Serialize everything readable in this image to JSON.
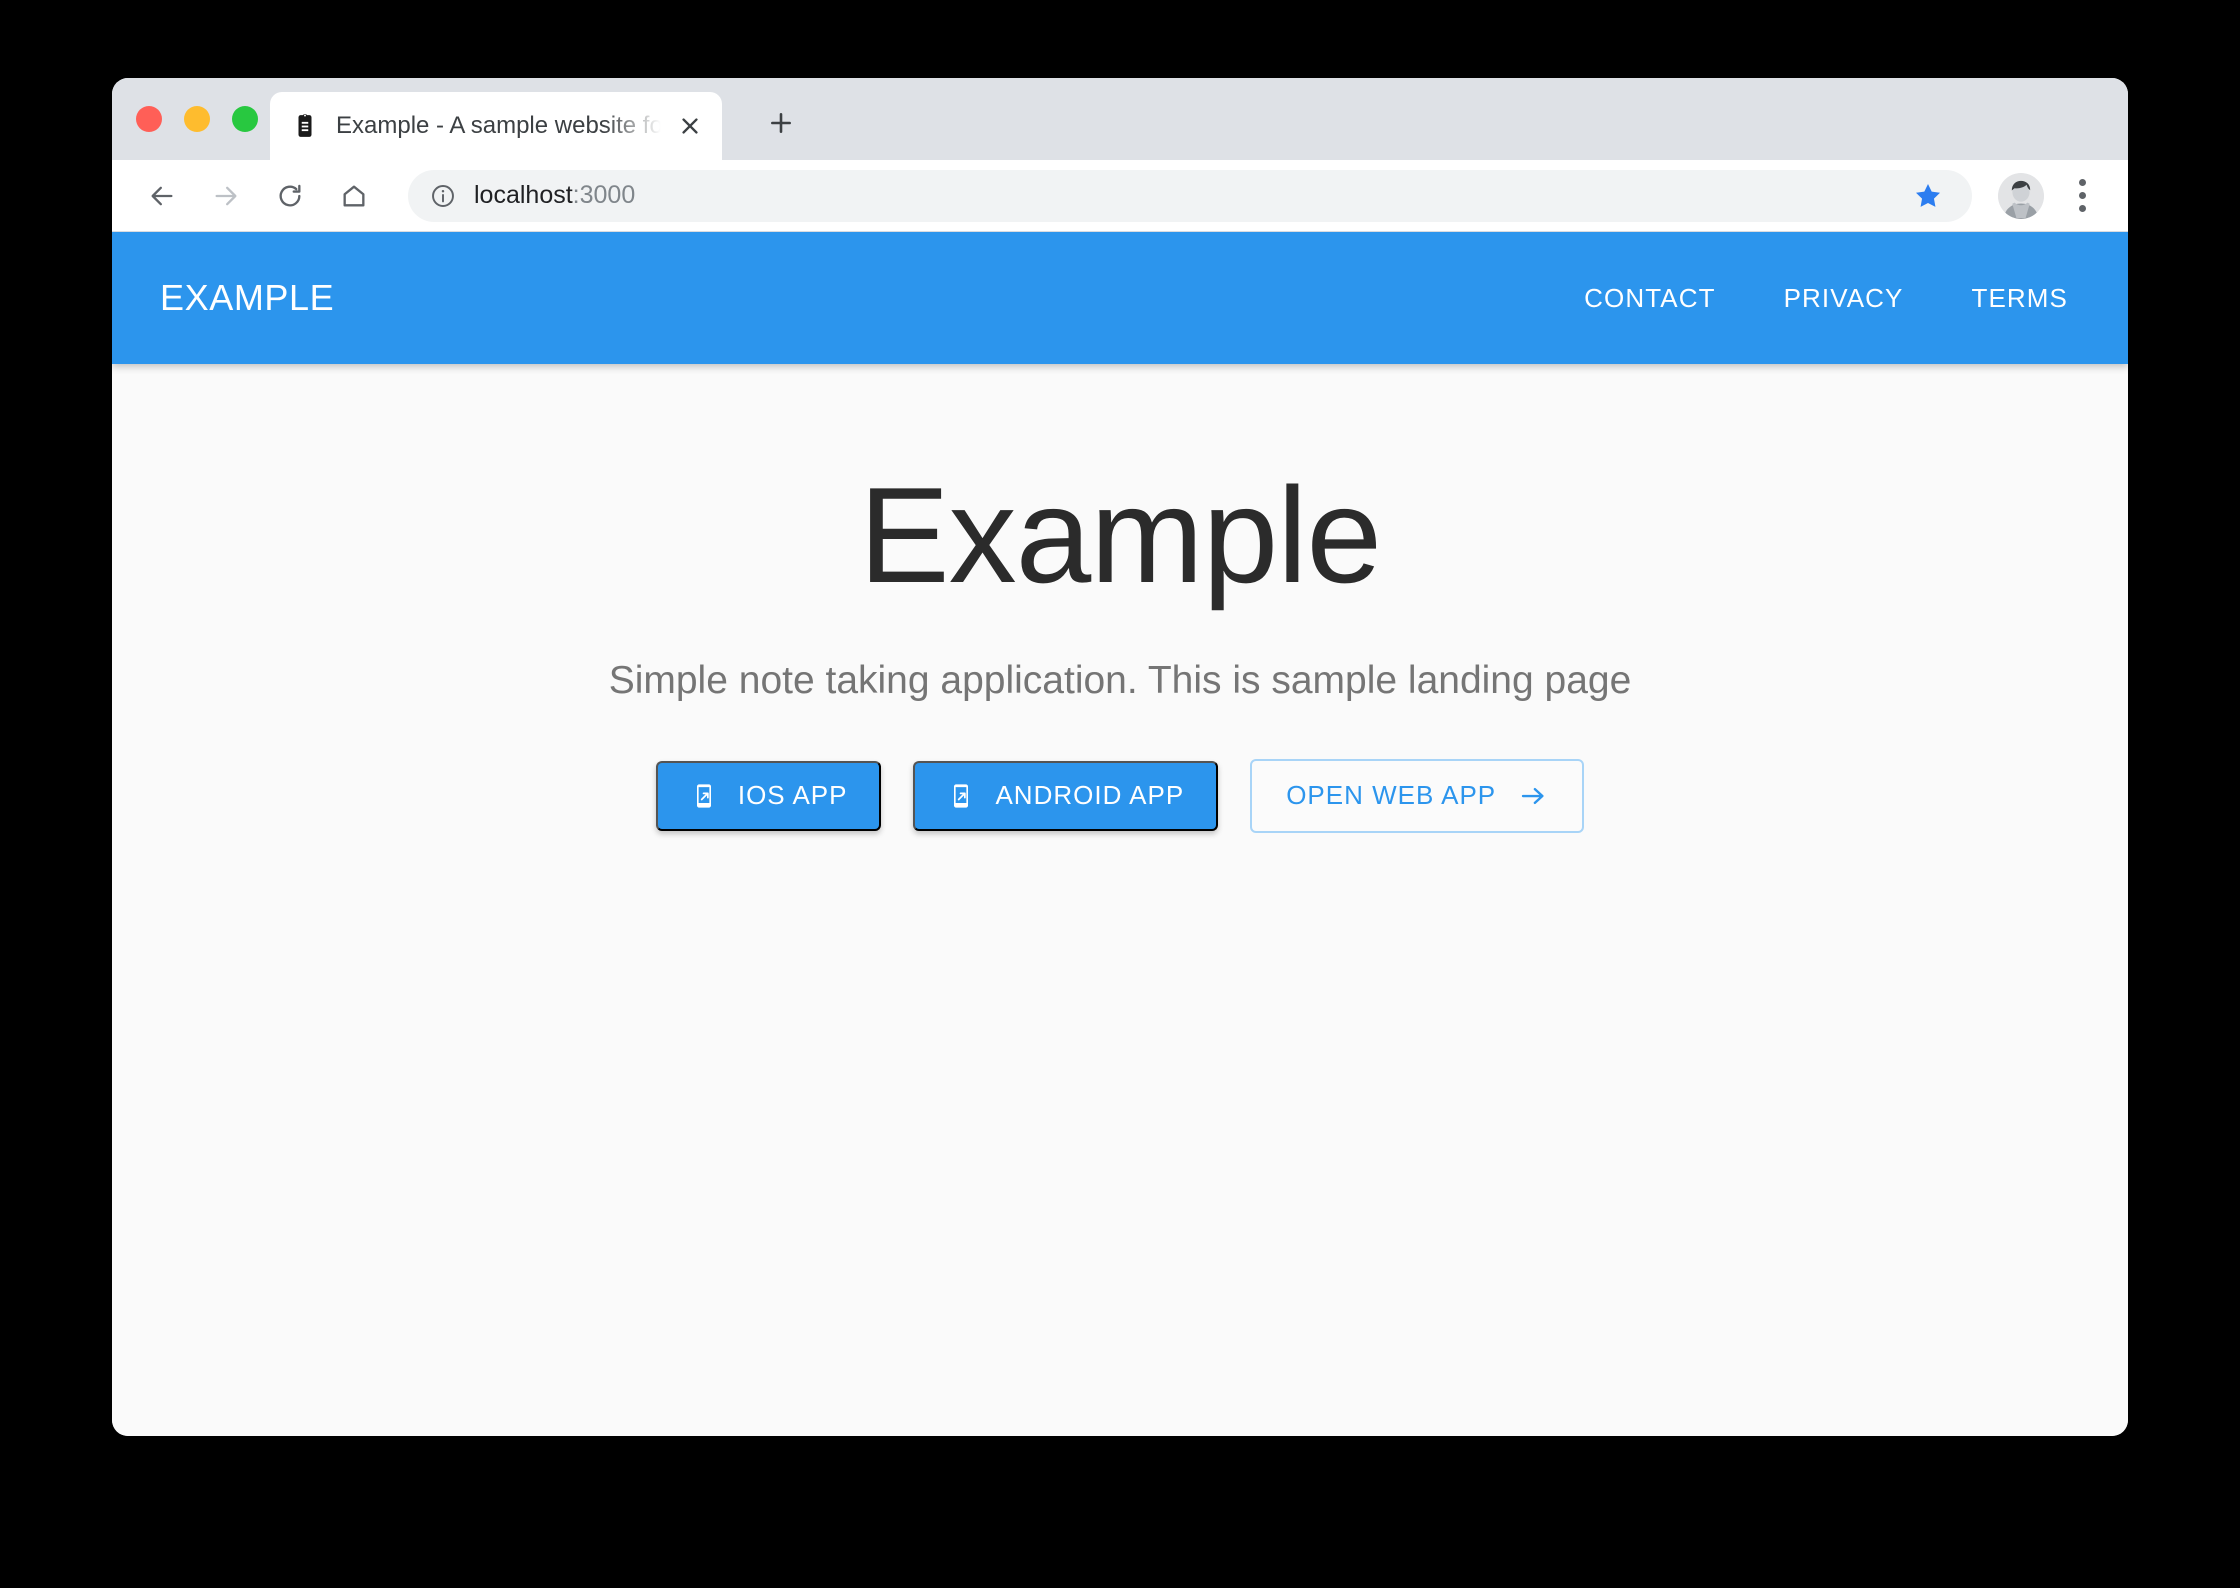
{
  "browser": {
    "window_controls": {
      "close_label": "close",
      "minimize_label": "minimize",
      "maximize_label": "maximize"
    },
    "tab": {
      "title": "Example - A sample website for testing",
      "favicon": "clipboard-note-icon",
      "close_label": "×"
    },
    "new_tab_label": "+",
    "toolbar": {
      "back_label": "Back",
      "forward_label": "Forward",
      "reload_label": "Reload",
      "home_label": "Home",
      "security_icon": "info-circle-icon",
      "url_host": "localhost",
      "url_port": ":3000",
      "bookmark_icon": "star-filled-icon",
      "bookmark_state": "bookmarked",
      "avatar_label": "Profile",
      "menu_label": "Customize and control"
    }
  },
  "site": {
    "header": {
      "brand": "EXAMPLE",
      "nav": [
        {
          "label": "CONTACT"
        },
        {
          "label": "PRIVACY"
        },
        {
          "label": "TERMS"
        }
      ]
    },
    "hero": {
      "title": "Example",
      "subtitle": "Simple note taking application. This is sample landing page",
      "buttons": [
        {
          "label": "IOS APP",
          "icon": "mobile-launch-icon",
          "style": "filled"
        },
        {
          "label": "ANDROID APP",
          "icon": "mobile-launch-icon",
          "style": "filled"
        },
        {
          "label": "OPEN WEB APP",
          "icon": "arrow-right-icon",
          "style": "outlined"
        }
      ]
    }
  },
  "colors": {
    "brand_blue": "#2c95ed",
    "outline_blue": "#a8d4f7",
    "page_background": "#fafafa",
    "tabstrip_grey": "#dee1e6",
    "heading": "#2b2b2b",
    "subtitle": "#757575"
  }
}
